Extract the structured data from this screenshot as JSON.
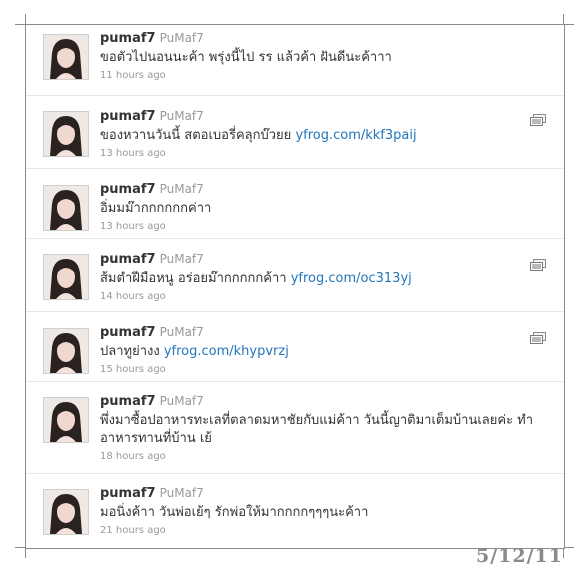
{
  "tweets": [
    {
      "user": "pumaf7",
      "handle": "PuMaf7",
      "text": "ขอตัวไปนอนนะค้า พรุ่งนี้ไป รร แล้วค้า ฝันดีนะค้าาา",
      "link": "",
      "time": "11 hours ago",
      "has_media": false
    },
    {
      "user": "pumaf7",
      "handle": "PuMaf7",
      "text": "ของหวานวันนี้ สตอเบอรี่คลุกบ๊วยย",
      "link": "yfrog.com/kkf3paij",
      "time": "13 hours ago",
      "has_media": true
    },
    {
      "user": "pumaf7",
      "handle": "PuMaf7",
      "text": "อิ่มมม๊ากกกกกกค่าา",
      "link": "",
      "time": "13 hours ago",
      "has_media": false
    },
    {
      "user": "pumaf7",
      "handle": "PuMaf7",
      "text": "ส้มตำฝีมือหนู อร่อยม๊ากกกกกค้าา",
      "link": "yfrog.com/oc313yj",
      "time": "14 hours ago",
      "has_media": true
    },
    {
      "user": "pumaf7",
      "handle": "PuMaf7",
      "text": "ปลาทูย่างง",
      "link": "yfrog.com/khypvrzj",
      "time": "15 hours ago",
      "has_media": true
    },
    {
      "user": "pumaf7",
      "handle": "PuMaf7",
      "text": "พึ่งมาซื้อปอาหารทะเลที่ตลาดมหาชัยกับแม่ค้าา วันนี้ญาติมาเต็มบ้านเลยค่ะ ทำอาหารทานที่บ้าน เย้",
      "link": "",
      "time": "18 hours ago",
      "has_media": false
    },
    {
      "user": "pumaf7",
      "handle": "PuMaf7",
      "text": "มอนิ่งค้าา วันพ่อเย้ๆ รักพ่อให้มากกกกๆๆๆนะค้าา",
      "link": "",
      "time": "21 hours ago",
      "has_media": false
    }
  ],
  "date_stamp": "5/12/11",
  "icons": {
    "media": "photo-attachment-icon"
  }
}
